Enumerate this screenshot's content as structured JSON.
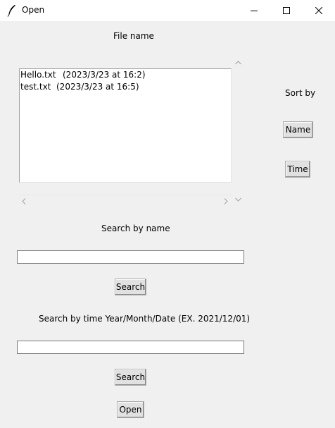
{
  "window": {
    "title": "Open",
    "icon": "feather-icon",
    "controls": [
      "minimize-icon",
      "maximize-icon",
      "close-icon"
    ]
  },
  "file_list": {
    "heading": "File name",
    "items": [
      {
        "name": "Hello.txt",
        "time": "(2023/3/23 at 16:2)"
      },
      {
        "name": "test.txt",
        "time": "(2023/3/23 at 16:5)"
      }
    ]
  },
  "sort": {
    "label": "Sort by",
    "name_button": "Name",
    "time_button": "Time"
  },
  "search_name": {
    "label": "Search by name",
    "value": "",
    "button": "Search"
  },
  "search_time": {
    "label": "Search by time Year/Month/Date (EX. 2021/12/01)",
    "value": "",
    "button": "Search"
  },
  "open_button": "Open"
}
